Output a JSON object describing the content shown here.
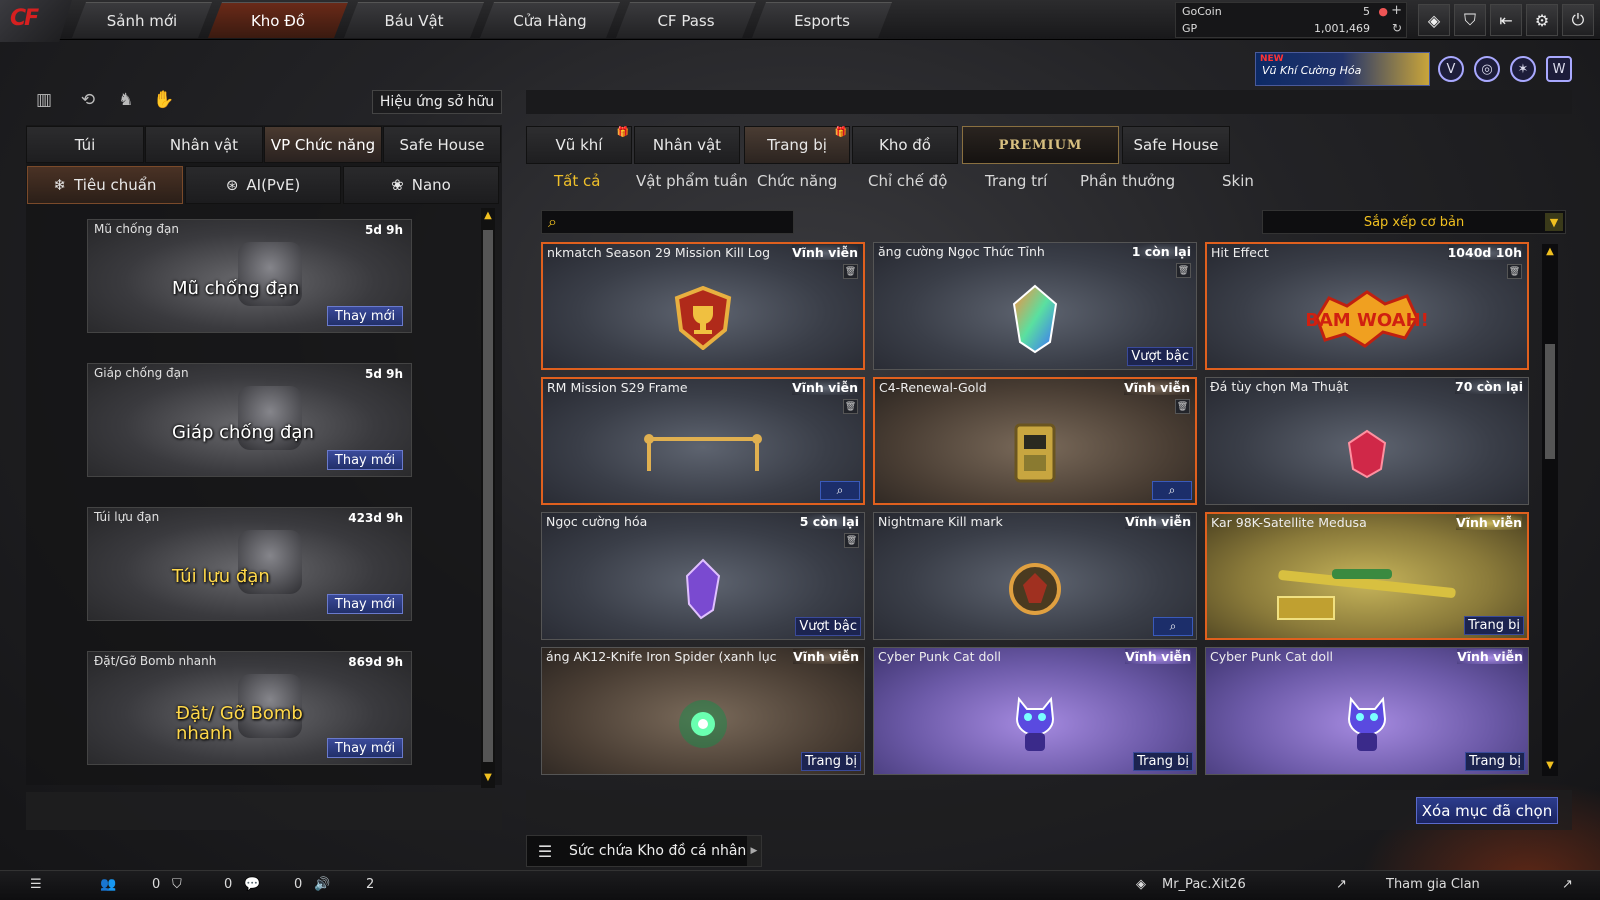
{
  "colors": {
    "accent_gold": "#f0c02a",
    "selected_border": "#e0601e",
    "button_blue": "#22306a"
  },
  "nav": {
    "tabs": [
      "Sảnh mới",
      "Kho Đồ",
      "Báu Vật",
      "Cửa Hàng",
      "CF Pass",
      "Esports"
    ],
    "active": "Kho Đồ",
    "logo": "CF"
  },
  "currency": {
    "gocoin_label": "GoCoin",
    "gocoin_value": "5",
    "gp_label": "GP",
    "gp_value": "1,001,469"
  },
  "banner": {
    "badge": "NEW",
    "text": "Vũ Khí Cường Hóa"
  },
  "left": {
    "own_effect_button": "Hiệu ứng sở hữu",
    "tabs": [
      "Túi",
      "Nhân vật",
      "VP Chức năng",
      "Safe House"
    ],
    "active_tab": "VP Chức năng",
    "subtabs": [
      "Tiêu chuẩn",
      "AI(PvE)",
      "Nano"
    ],
    "items": [
      {
        "name": "Mũ chống đạn",
        "time": "5d 9h",
        "big": "Mũ chống đạn",
        "button": "Thay mới"
      },
      {
        "name": "Giáp chống đạn",
        "time": "5d 9h",
        "big": "Giáp chống đạn",
        "button": "Thay mới"
      },
      {
        "name": "Túi lựu đạn",
        "time": "423d 9h",
        "big": "Túi lựu đạn",
        "button": "Thay mới"
      },
      {
        "name": "Đặt/Gỡ Bomb nhanh",
        "time": "869d 9h",
        "big": "Đặt/ Gỡ Bomb nhanh",
        "button": "Thay mới"
      }
    ]
  },
  "right": {
    "tabs": [
      "Vũ khí",
      "Nhân vật",
      "Trang bị",
      "Kho đồ"
    ],
    "premium": "PREMIUM",
    "safehouse": "Safe House",
    "active_tab": "Trang bị",
    "categories": [
      "Tất cả",
      "Vật phẩm tuần",
      "Chức năng",
      "Chỉ chế độ",
      "Trang trí",
      "Phần thưởng",
      "Skin"
    ],
    "active_category": "Tất cả",
    "sort": "Sắp xếp cơ bản",
    "items": [
      {
        "name": "nkmatch Season 29 Mission Kill Log",
        "time": "Vĩnh viễn",
        "icon": "trophy-shield-icon",
        "action": ""
      },
      {
        "name": "ăng cường Ngọc Thức Tỉnh",
        "time": "1 còn lại",
        "icon": "crystal-gem-icon",
        "action": "Vượt bậc"
      },
      {
        "name": "Hit Effect",
        "time": "1040d 10h",
        "icon": "bam-woah-icon",
        "action": ""
      },
      {
        "name": "RM Mission S29 Frame",
        "time": "Vĩnh viễn",
        "icon": "gold-frame-icon",
        "action": "search"
      },
      {
        "name": "C4-Renewal-Gold",
        "time": "Vĩnh viễn",
        "icon": "c4-gold-icon",
        "action": "search"
      },
      {
        "name": "Đá tùy chọn Ma Thuật",
        "time": "70 còn lại",
        "icon": "red-gem-icon",
        "action": ""
      },
      {
        "name": "Ngọc cường hóa",
        "time": "5 còn lại",
        "icon": "purple-crystal-icon",
        "action": "Vượt bậc"
      },
      {
        "name": "Nightmare Kill mark",
        "time": "Vĩnh viễn",
        "icon": "kill-mark-icon",
        "action": "search"
      },
      {
        "name": "Kar 98K-Satellite Medusa",
        "time": "Vĩnh viễn",
        "icon": "sniper-rifle-icon",
        "action": "Trang bị"
      },
      {
        "name": "áng AK12-Knife Iron Spider (xanh lục)",
        "time": "Vĩnh viễn",
        "icon": "green-orb-icon",
        "action": "Trang bị"
      },
      {
        "name": "Cyber Punk Cat doll",
        "time": "Vĩnh viễn",
        "icon": "cat-doll-icon",
        "action": "Trang bị"
      },
      {
        "name": "Cyber Punk Cat doll",
        "time": "Vĩnh viễn",
        "icon": "cat-doll-icon",
        "action": "Trang bị"
      }
    ],
    "delete_button": "Xóa mục đã chọn",
    "capacity": "Sức chứa Kho đồ cá nhân"
  },
  "status": {
    "counts": [
      "0",
      "0",
      "0",
      "2"
    ],
    "player": "Mr_Pac.Xit26",
    "clan": "Tham gia Clan"
  }
}
